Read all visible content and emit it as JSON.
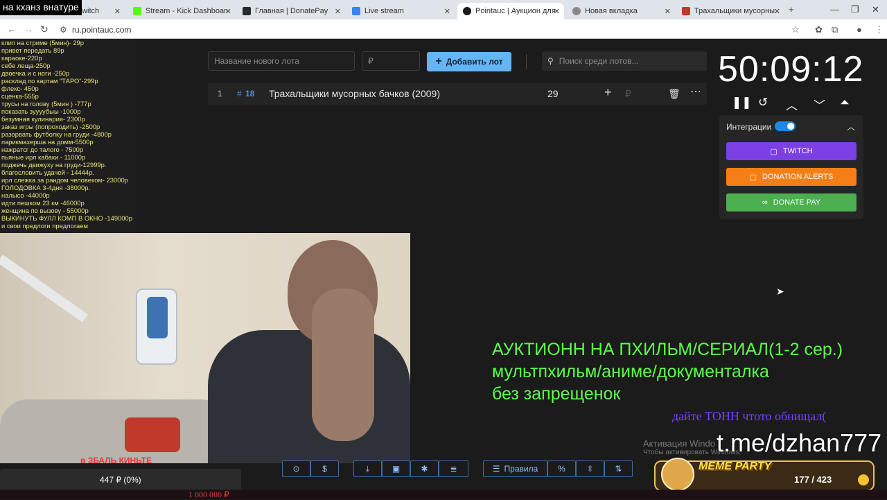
{
  "stream_title": "на кханз внатуре",
  "browser": {
    "tabs": [
      {
        "label": "Twitch",
        "color": "#9146ff"
      },
      {
        "label": "Stream - Kick Dashboard",
        "color": "#53fc18"
      },
      {
        "label": "Главная | DonatePay",
        "color": "#2a2a2a"
      },
      {
        "label": "Live stream",
        "color": "#3b82f6"
      },
      {
        "label": "Pointauc | Аукцион для стрим…",
        "color": "#1b1b1b"
      },
      {
        "label": "Новая вкладка",
        "color": "#888888"
      },
      {
        "label": "Трахальщики мусорных бачк…",
        "color": "#c0392b"
      }
    ],
    "url": "ru.pointauc.com"
  },
  "price_list": [
    "клип на стриме (5мин)- 29р",
    "привет передать 89р",
    "караоке-220р",
    "себе леща-250р",
    "двоечка и с ноги -250р",
    "расклад по картам \"ТАРО\"-299р",
    "флекс- 450р",
    "сценка-555р",
    "трусы на голову (5мин ) -777р",
    "показать зуууубыы -1000р",
    "безумная кулинария- 2300р",
    "заказ игры (попроходить) -2500р",
    "разорвать футболку на груди -4800р",
    "парикмахерша на домм-5500р",
    "нажратсг до талого - 7500р",
    "пьяные ирл кабаки - 11000р",
    "поджечь движуху на груди-12999р.",
    "благословить удачей - 14444р.",
    "ирл слежка за рандом человеком- 23000р",
    "ГОЛОДОВКА 3-4дня -38000р.",
    "налысо -44000р",
    "идти пешком 23 км -46000р",
    "женщина по вызову - 55000р",
    "ВЫКИНУТЬ ФУЛЛ КОМП В ОКНО -149000р",
    "и свои предлоги предлогаем"
  ],
  "auction": {
    "new_lot_placeholder": "Название нового лота",
    "amount_placeholder": "₽",
    "add_lot_label": "Добавить лот",
    "search_placeholder": "Поиск среди лотов...",
    "lots": [
      {
        "index": "1",
        "id": "18",
        "name": "Трахальщики мусорных бачков (2009)",
        "amount": "29"
      }
    ]
  },
  "timer": "50:09:12",
  "integrations": {
    "title": "Интеграции",
    "twitch_label": "TWITCH",
    "donation_alerts_label": "DONATION ALERTS",
    "donatepay_label": "DONATE PAY",
    "colors": {
      "twitch": "#7b3fe4",
      "donation_alerts": "#f57f17",
      "donatepay": "#4caf50"
    }
  },
  "overlay": {
    "auction_lines": [
      "АУКТИОНН НА ПХИЛЬМ/СЕРИАЛ(1-2 сер.)",
      "мультпхильм/аниме/документалка",
      "без запрещенок"
    ],
    "donate_text": "дайте ТОНН чтото обнищал(",
    "telegram": "t.me/dzhan777",
    "activation_title": "Активация Windo",
    "activation_sub": "Чтобы активировать Windows,",
    "red_text": "в ЗБАЛЬ КИНЬТЕ"
  },
  "bottom": {
    "balance": "447 ₽ (0%)",
    "rules_label": "Правила",
    "goal_amount": "1 000 000 ₽"
  },
  "meme_party": {
    "title": "MEME PARTY",
    "progress": "177 / 423"
  }
}
